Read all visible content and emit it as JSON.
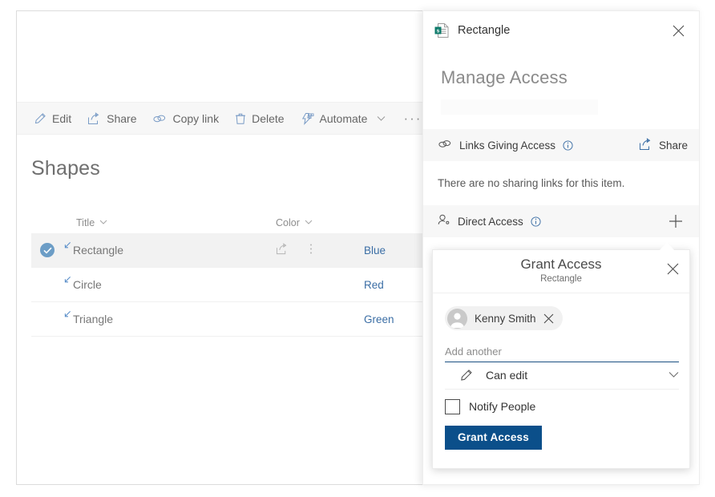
{
  "colors": {
    "accent_blue": "#0b4f8a",
    "link_blue": "#3b6ea5",
    "selection_blue": "#6c9dc6",
    "sharepoint_teal": "#077568",
    "command_bar_bg": "#f7f7f7",
    "selected_row_bg": "#f2f2f2"
  },
  "command_bar": {
    "items": [
      {
        "label": "Edit",
        "icon": "pencil-icon",
        "has_chevron": false
      },
      {
        "label": "Share",
        "icon": "share-icon",
        "has_chevron": false
      },
      {
        "label": "Copy link",
        "icon": "link-icon",
        "has_chevron": false
      },
      {
        "label": "Delete",
        "icon": "trash-icon",
        "has_chevron": false
      },
      {
        "label": "Automate",
        "icon": "automate-icon",
        "has_chevron": true
      }
    ],
    "overflow_label": "···"
  },
  "list": {
    "title": "Shapes",
    "columns": [
      {
        "label": "Title",
        "sort_indicator": "⌄"
      },
      {
        "label": "Color",
        "sort_indicator": "⌄"
      }
    ],
    "rows": [
      {
        "title": "Rectangle",
        "color": "Blue",
        "selected": true,
        "shared": true,
        "share_icon": "share-icon",
        "more_icon": "kebab-icon"
      },
      {
        "title": "Circle",
        "color": "Red",
        "selected": false,
        "shared": true
      },
      {
        "title": "Triangle",
        "color": "Green",
        "selected": false,
        "shared": true
      }
    ]
  },
  "panel": {
    "file_name": "Rectangle",
    "file_icon": "sharepoint-list-item-icon",
    "close_icon": "close-icon",
    "heading": "Manage Access",
    "links_section": {
      "label": "Links Giving Access",
      "icon": "link-icon",
      "info_icon": "info-icon",
      "action_label": "Share",
      "action_icon": "share-icon",
      "empty_note": "There are no sharing links for this item."
    },
    "direct_section": {
      "label": "Direct Access",
      "icon": "person-icon",
      "info_icon": "info-icon",
      "add_icon": "plus-icon"
    }
  },
  "grant_access_dialog": {
    "title": "Grant Access",
    "subtitle": "Rectangle",
    "close_icon": "close-icon",
    "recipients": [
      {
        "name": "Kenny Smith",
        "avatar_icon": "person-avatar-icon",
        "remove_icon": "close-icon"
      }
    ],
    "add_another_placeholder": "Add another",
    "permission": {
      "value": "Can edit",
      "icon": "pencil-icon",
      "chevron_icon": "chevron-down-icon"
    },
    "notify": {
      "label": "Notify People",
      "checked": false
    },
    "submit_label": "Grant Access"
  }
}
